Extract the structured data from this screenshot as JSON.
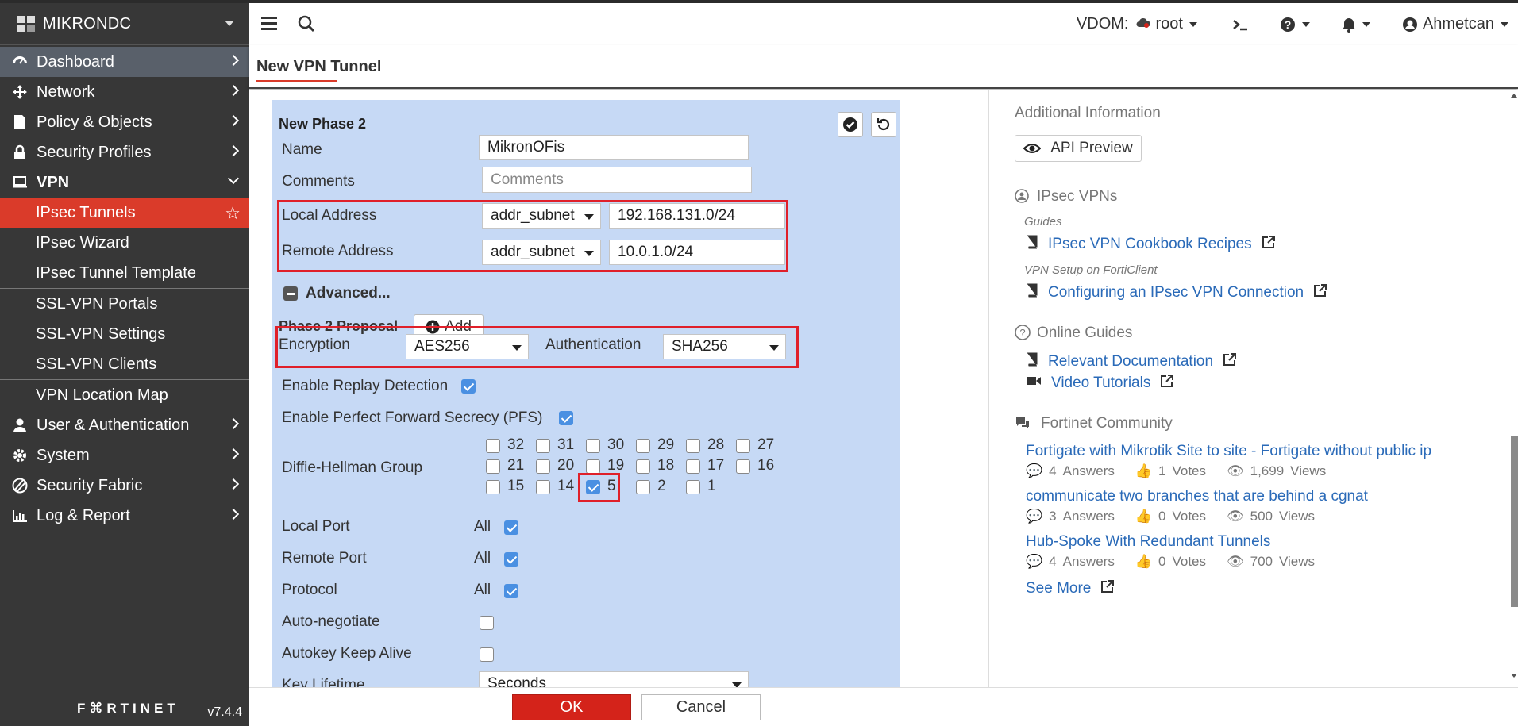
{
  "sidebar": {
    "brand": "MIKRONDC",
    "items": [
      {
        "label": "Dashboard"
      },
      {
        "label": "Network"
      },
      {
        "label": "Policy & Objects"
      },
      {
        "label": "Security Profiles"
      },
      {
        "label": "VPN"
      }
    ],
    "vpn_sub": [
      {
        "label": "IPsec Tunnels"
      },
      {
        "label": "IPsec Wizard"
      },
      {
        "label": "IPsec Tunnel Template"
      },
      {
        "label": "SSL-VPN Portals"
      },
      {
        "label": "SSL-VPN Settings"
      },
      {
        "label": "SSL-VPN Clients"
      },
      {
        "label": "VPN Location Map"
      }
    ],
    "items_after": [
      {
        "label": "User & Authentication"
      },
      {
        "label": "System"
      },
      {
        "label": "Security Fabric"
      },
      {
        "label": "Log & Report"
      }
    ],
    "footer_logo": "F⌘RTINET",
    "version": "v7.4.4"
  },
  "header": {
    "vdom_label": "VDOM:",
    "vdom_value": "root",
    "user": "Ahmetcan"
  },
  "page": {
    "title": "New VPN Tunnel"
  },
  "phase2": {
    "title": "New Phase 2",
    "name_label": "Name",
    "name_value": "MikronOFis",
    "comments_label": "Comments",
    "comments_placeholder": "Comments",
    "local_label": "Local Address",
    "local_type": "addr_subnet",
    "local_value": "192.168.131.0/24",
    "remote_label": "Remote Address",
    "remote_type": "addr_subnet",
    "remote_value": "10.0.1.0/24",
    "advanced_label": "Advanced...",
    "proposal_label": "Phase 2 Proposal",
    "add_label": "Add",
    "encryption_label": "Encryption",
    "encryption_value": "AES256",
    "auth_label": "Authentication",
    "auth_value": "SHA256",
    "replay_label": "Enable Replay Detection",
    "pfs_label": "Enable Perfect Forward Secrecy (PFS)",
    "dh_label": "Diffie-Hellman Group",
    "dh_groups": [
      [
        "32",
        "31",
        "30",
        "29",
        "28",
        "27"
      ],
      [
        "21",
        "20",
        "19",
        "18",
        "17",
        "16"
      ],
      [
        "15",
        "14",
        "5",
        "2",
        "1"
      ]
    ],
    "dh_selected": "5",
    "local_port_label": "Local Port",
    "local_port_value": "All",
    "remote_port_label": "Remote Port",
    "remote_port_value": "All",
    "protocol_label": "Protocol",
    "protocol_value": "All",
    "autoneg_label": "Auto-negotiate",
    "keepalive_label": "Autokey Keep Alive",
    "lifetime_label": "Key Lifetime",
    "lifetime_value": "Seconds"
  },
  "info": {
    "heading": "Additional Information",
    "api_preview": "API Preview",
    "ipsec_heading": "IPsec VPNs",
    "guides_label": "Guides",
    "cookbook_link": "IPsec VPN Cookbook Recipes",
    "forticlient_label": "VPN Setup on FortiClient",
    "config_link": "Configuring an IPsec VPN Connection",
    "online_heading": "Online Guides",
    "docs_link": "Relevant Documentation",
    "video_link": "Video Tutorials",
    "community_heading": "Fortinet Community",
    "posts": [
      {
        "title": "Fortigate with Mikrotik Site to site - Fortigate without public ip",
        "answers": "4",
        "answers_label": "Answers",
        "votes": "1",
        "votes_label": "Votes",
        "views": "1,699",
        "views_label": "Views"
      },
      {
        "title": "communicate two branches that are behind a cgnat",
        "answers": "3",
        "answers_label": "Answers",
        "votes": "0",
        "votes_label": "Votes",
        "views": "500",
        "views_label": "Views"
      },
      {
        "title": "Hub-Spoke With Redundant Tunnels",
        "answers": "4",
        "answers_label": "Answers",
        "votes": "0",
        "votes_label": "Votes",
        "views": "700",
        "views_label": "Views"
      }
    ],
    "see_more": "See More"
  },
  "footer": {
    "ok": "OK",
    "cancel": "Cancel"
  },
  "colors": {
    "sidebar_bg": "#373737",
    "accent_red": "#da3b2a",
    "panel_blue": "#c6d9f5",
    "link_blue": "#2a6ab8"
  }
}
